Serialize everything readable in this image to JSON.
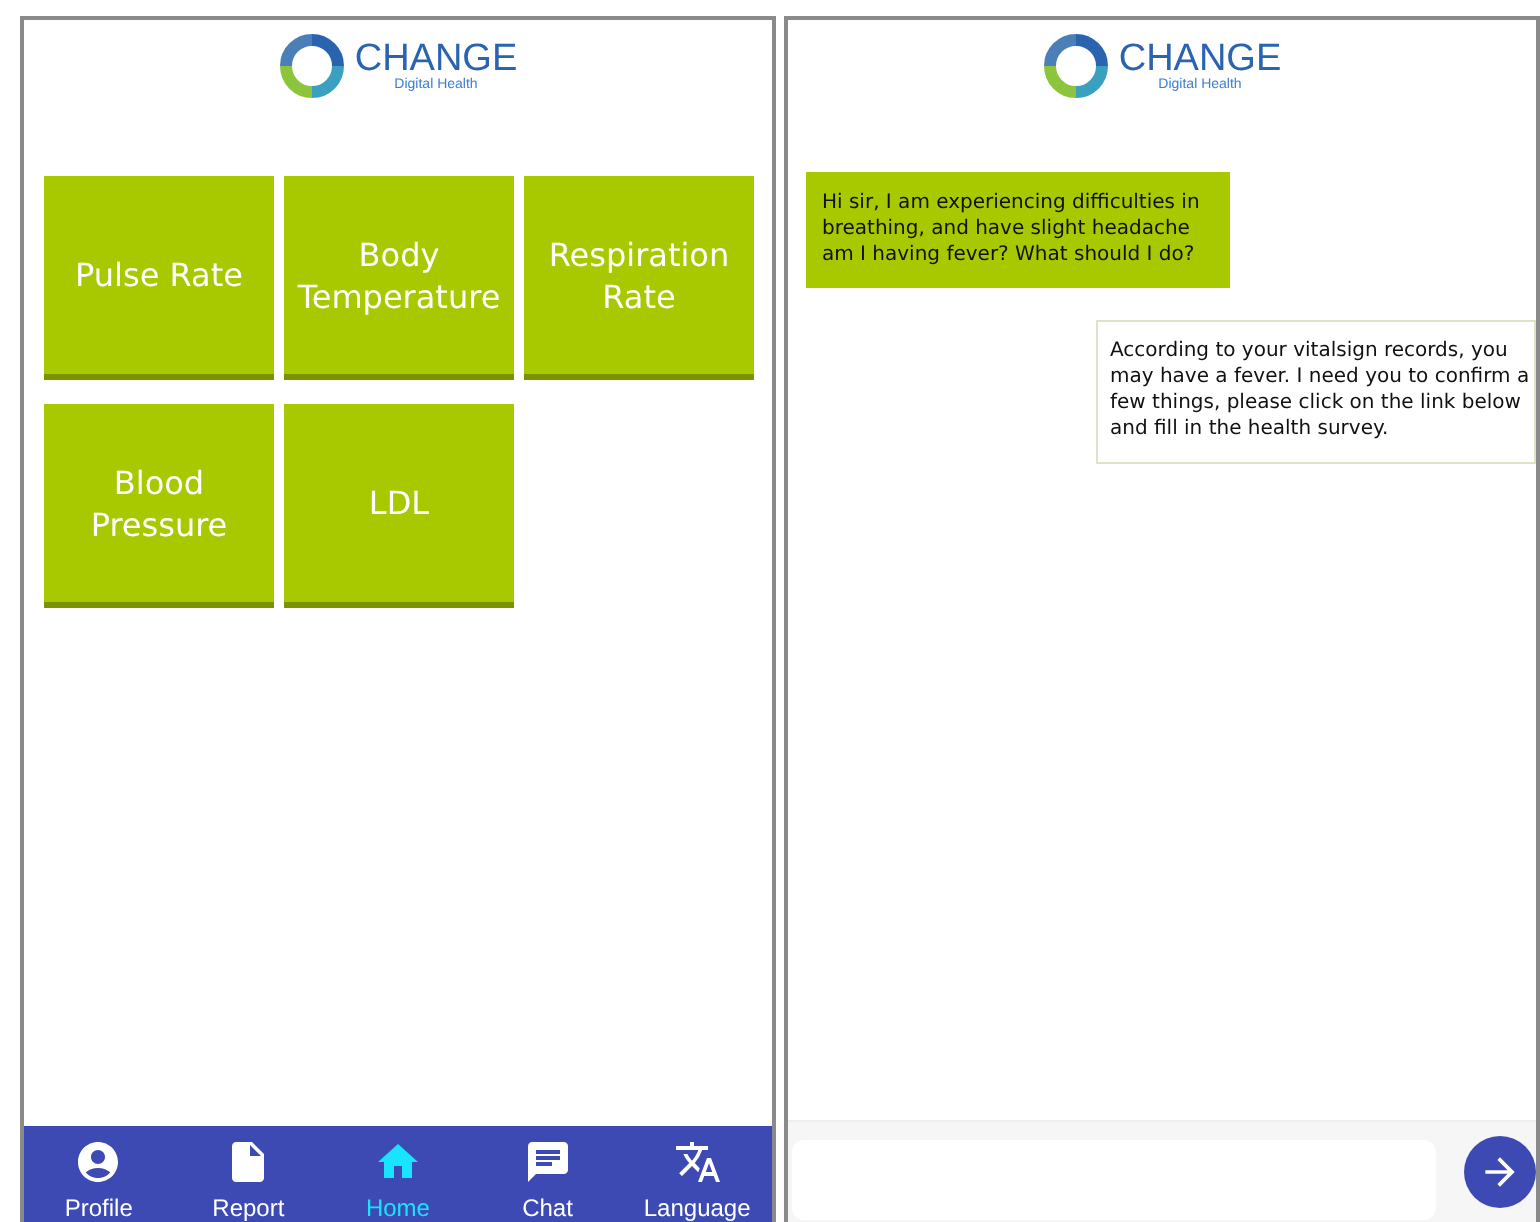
{
  "home_screen": {
    "logo": {
      "name": "CHANGE",
      "tagline": "Digital Health"
    },
    "tiles": [
      {
        "label": "Pulse Rate"
      },
      {
        "label": "Body Temperature"
      },
      {
        "label": "Respiration Rate"
      },
      {
        "label": "Blood Pressure"
      },
      {
        "label": "LDL"
      }
    ],
    "nav": [
      {
        "label": "Profile",
        "kind": "person",
        "selected": false
      },
      {
        "label": "Report",
        "kind": "file",
        "selected": false
      },
      {
        "label": "Home",
        "kind": "home",
        "selected": true
      },
      {
        "label": "Chat",
        "kind": "chat",
        "selected": false
      },
      {
        "label": "Language",
        "kind": "translate",
        "selected": false
      }
    ]
  },
  "chat_screen": {
    "logo": {
      "name": "CHANGE",
      "tagline": "Digital Health"
    },
    "messages": [
      {
        "kind": "sent",
        "text": "Hi sir, I am experiencing difficulties in breathing, and have slight headache am I having fever? What should I do?"
      },
      {
        "kind": "received",
        "text": "According to your vitalsign records, you may have a fever. I need you to confirm a few things, please click on the link below and fill in the health survey."
      }
    ]
  }
}
